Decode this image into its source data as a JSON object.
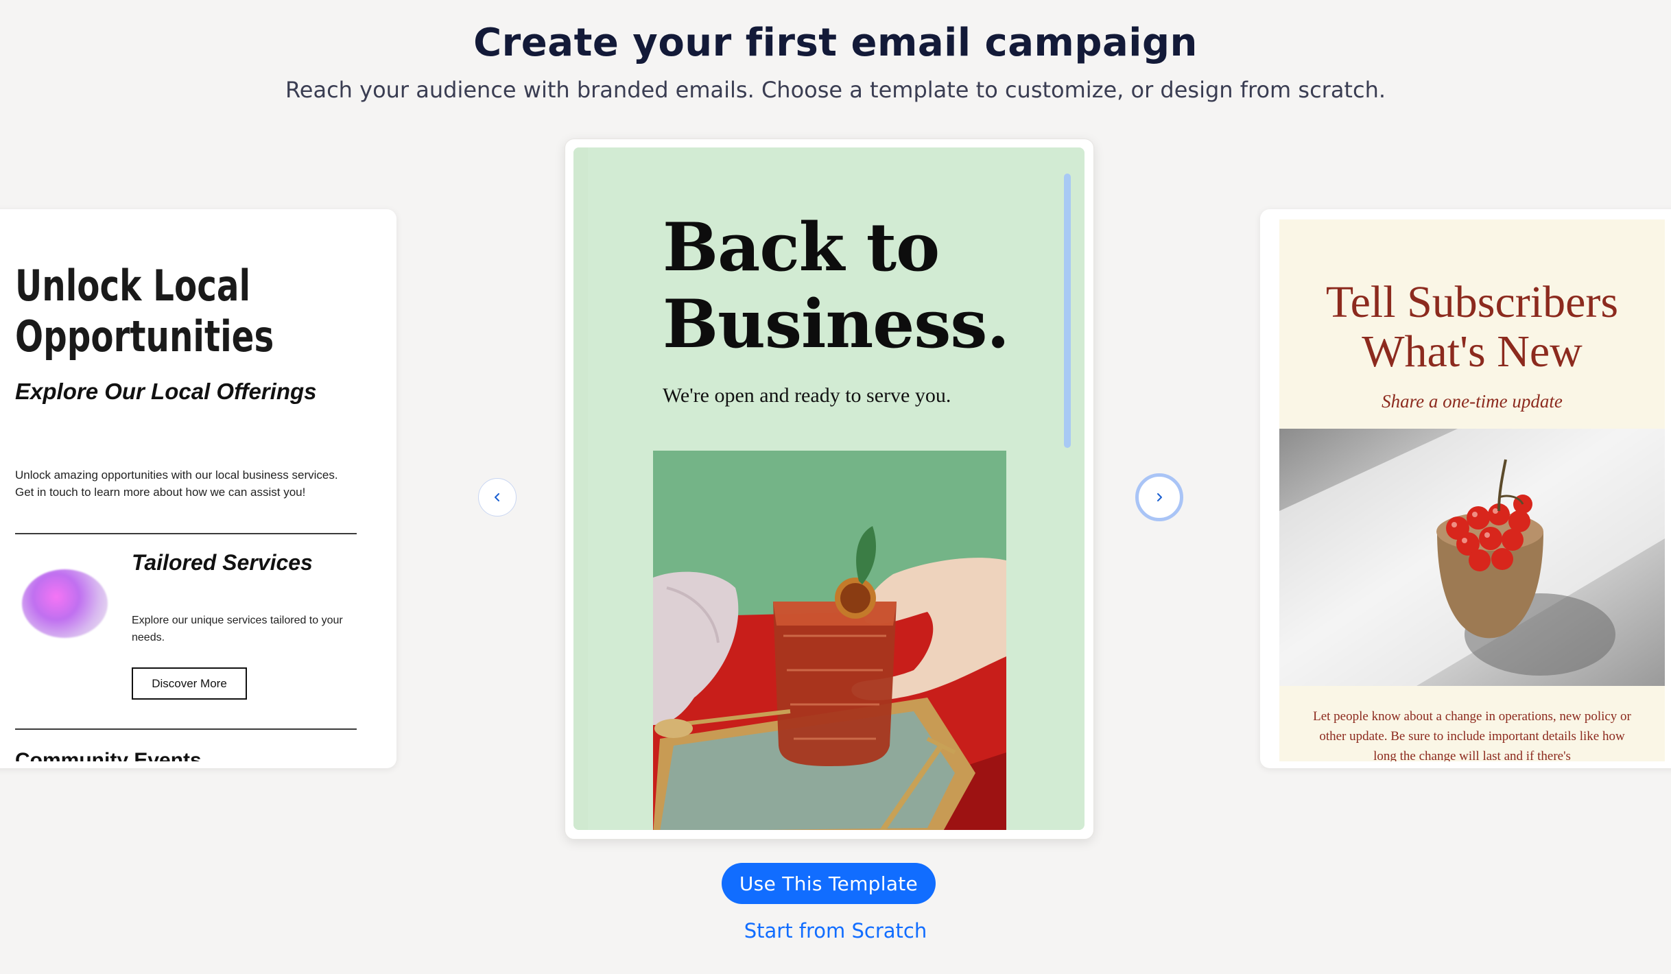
{
  "header": {
    "title": "Create your first email campaign",
    "subtitle": "Reach your audience with branded emails. Choose a template to customize, or design from scratch."
  },
  "templates": {
    "left": {
      "title_line1": "Unlock Local",
      "title_line2": "Opportunities",
      "subtitle": "Explore Our Local Offerings",
      "body_line1": "Unlock amazing opportunities with our local business services.",
      "body_line2": "Get in touch to learn more about how we can assist you!",
      "services_title": "Tailored Services",
      "services_body": "Explore our unique services tailored to your needs.",
      "button_label": "Discover More",
      "cutoff_heading": "Community Events"
    },
    "center": {
      "title_line1": "Back to",
      "title_line2": "Business.",
      "tagline": "We're open and ready to serve you."
    },
    "right": {
      "title_line1": "Tell Subscribers",
      "title_line2": "What's New",
      "subtitle": "Share a one-time update",
      "body": "Let people know about a change in operations, new policy or other update. Be sure to include important details like how long the change will last and if there's"
    }
  },
  "carousel": {
    "prev_icon": "chevron-left-icon",
    "next_icon": "chevron-right-icon"
  },
  "actions": {
    "use_template": "Use This Template",
    "start_scratch": "Start from Scratch"
  },
  "colors": {
    "background": "#f5f4f3",
    "title": "#131a38",
    "accent": "#116dff",
    "center_template_bg": "#d2ebd3",
    "right_template_bg": "#faf6e6",
    "right_template_text": "#8c2a1e",
    "scrollbar_thumb": "#a8c9f4"
  }
}
